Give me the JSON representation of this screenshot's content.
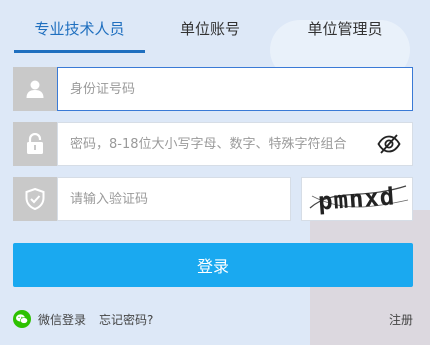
{
  "tabs": [
    {
      "label": "专业技术人员",
      "active": true
    },
    {
      "label": "单位账号",
      "active": false
    },
    {
      "label": "单位管理员",
      "active": false
    }
  ],
  "form": {
    "id_number_placeholder": "身份证号码",
    "password_placeholder": "密码，8-18位大小写字母、数字、特殊字符组合",
    "captcha_placeholder": "请输入验证码",
    "captcha_text": "pmnxd"
  },
  "buttons": {
    "login": "登录"
  },
  "links": {
    "wechat_login": "微信登录",
    "forgot_password": "忘记密码?",
    "register": "注册"
  },
  "colors": {
    "accent": "#1f6fbf",
    "login_button": "#1aa9f0",
    "icon_box": "#c9c9c9",
    "wechat": "#2dc100"
  },
  "icons": {
    "user": "user-icon",
    "lock": "lock-icon",
    "shield": "shield-check-icon",
    "password_toggle": "eye-slash-icon",
    "wechat": "wechat-icon"
  }
}
